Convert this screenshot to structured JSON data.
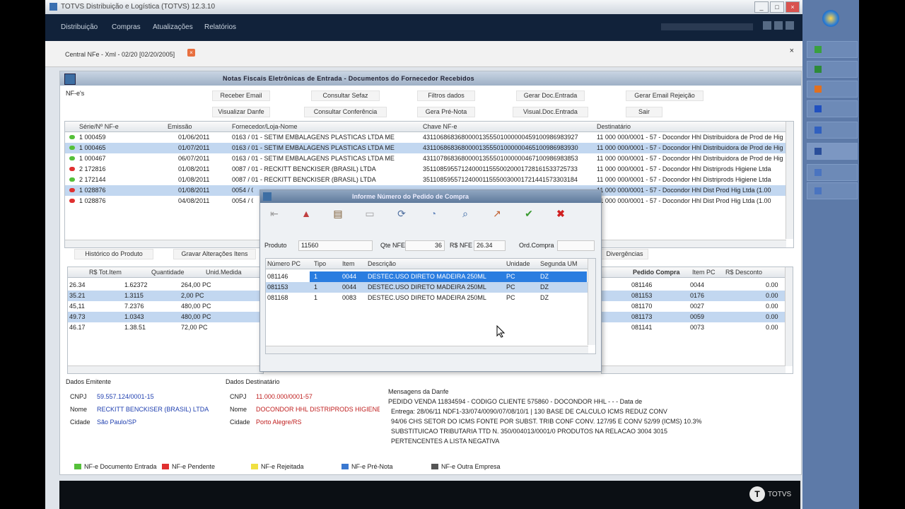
{
  "window": {
    "title": "TOTVS Distribuição e Logística (TOTVS) 12.3.10",
    "minimize": "_",
    "maximize": "□",
    "close": "×"
  },
  "menu": [
    "Distribuição",
    "Compras",
    "Atualizações",
    "Relatórios"
  ],
  "tab": {
    "label": "Central NFe - Xml - 02/20 [02/20/2005]",
    "close": "×",
    "panel_close": "×"
  },
  "panel": {
    "title": "Notas Fiscais Eletrônicas de Entrada - Documentos do Fornecedor Recebidos"
  },
  "nfe_label": "NF-e's",
  "buttons_row1": [
    "Receber Email",
    "Consultar Sefaz",
    "Filtros dados",
    "Gerar Doc.Entrada",
    "Gerar Email Rejeição"
  ],
  "buttons_row2": [
    "Visualizar Danfe",
    "Consultar Conferência",
    "Gera Pré-Nota",
    "Visual.Doc.Entrada",
    "Sair"
  ],
  "top_grid": {
    "headers": [
      "Série/Nº NF-e",
      "Emissão",
      "Fornecedor/Loja-Nome",
      "Chave NF-e",
      "Destinatário"
    ],
    "rows": [
      {
        "status": "green",
        "num": "1 000459",
        "date": "01/06/2011",
        "forn": "0163 / 01 - SETIM EMBALAGENS PLASTICAS LTDA ME",
        "chave": "43110686836800001355501000000459100986983927",
        "dest": "11 000 000/0001 - 57 - Docondor Hhl Distribuidora de Prod de Hig"
      },
      {
        "status": "green",
        "num": "1 000465",
        "date": "01/07/2011",
        "forn": "0163 / 01 - SETIM EMBALAGENS PLASTICAS LTDA ME",
        "chave": "43110686836800001355501000000465100986983930",
        "dest": "11 000 000/0001 - 57 - Docondor Hhl Distribuidora de Prod de Hig"
      },
      {
        "status": "green",
        "num": "1 000467",
        "date": "06/07/2011",
        "forn": "0163 / 01 - SETIM EMBALAGENS PLASTICAS LTDA ME",
        "chave": "43110786836800001355501000000467100986983853",
        "dest": "11 000 000/0001 - 57 - Docondor Hhl Distribuidora de Prod de Hig"
      },
      {
        "status": "red",
        "num": "2 172816",
        "date": "01/08/2011",
        "forn": "0087 / 01 - RECKITT BENCKISER (BRASIL) LTDA",
        "chave": "35110859557124000115550020001728161533725733",
        "dest": "11 000 000/0001 - 57 - Docondor Hhl Distriprods Higiene Ltda"
      },
      {
        "status": "green",
        "num": "2 172144",
        "date": "01/08/2011",
        "forn": "0087 / 01 - RECKITT BENCKISER (BRASIL) LTDA",
        "chave": "35110859557124000115550030001721441573303184",
        "dest": "11 000 000/0001 - 57 - Docondor Hhl Distriprods Higiene Ltda"
      },
      {
        "status": "red",
        "num": "1 028876",
        "date": "01/08/2011",
        "forn": "0054 / 01 - ...",
        "chave": "...",
        "dest": "11 000 000/0001 - 57 - Docondor Hhl Dist Prod Hig Ltda (1.00"
      },
      {
        "status": "red",
        "num": "1 028876",
        "date": "04/08/2011",
        "forn": "0054 / 01 - ...",
        "chave": "...",
        "dest": "11 000 000/0001 - 57 - Docondor Hhl Dist Prod Hig Ltda (1.00"
      }
    ]
  },
  "mid_buttons": [
    "Histórico do Produto",
    "Gravar Alterações Itens",
    "Divergências"
  ],
  "items_grid": {
    "headers": [
      "R$ Tot.Item",
      "Quantidade",
      "Unid.Medida"
    ],
    "rows": [
      [
        "26.34",
        "1.62372",
        "264,00 PC"
      ],
      [
        "35.21",
        "1.3115",
        "2,00 PC"
      ],
      [
        "45,11",
        "7.2376",
        "480,00 PC"
      ],
      [
        "49.73",
        "1.0343",
        "480,00 PC"
      ],
      [
        "46.17",
        "1.38.51",
        "72,00 PC"
      ]
    ]
  },
  "right_grid": {
    "headers": [
      "Pedido Compra",
      "Item PC",
      "R$ Desconto"
    ],
    "rows": [
      [
        "081146",
        "0044",
        "0.00"
      ],
      [
        "081153",
        "0176",
        "0.00"
      ],
      [
        "081170",
        "0027",
        "0.00"
      ],
      [
        "081173",
        "0059",
        "0.00"
      ],
      [
        "081141",
        "0073",
        "0.00"
      ]
    ]
  },
  "modal": {
    "title": "Informe Número do Pedido de Compra",
    "produto_label": "Produto",
    "produto_value": "11560",
    "qte_label": "Qte NFE",
    "qte_value": "36",
    "rs_label": "R$ NFE",
    "rs_value": "26.34",
    "ord_label": "Ord.Compra",
    "ord_value": "",
    "grid_headers": [
      "Número PC",
      "Tipo",
      "Item",
      "Descrição",
      "Unidade",
      "Segunda UM"
    ],
    "grid_rows": [
      {
        "pc": "081146",
        "tipo": "1",
        "item": "0044",
        "desc": "DESTEC.USO DIRETO MADEIRA 250ML",
        "un": "PC",
        "seg": "DZ"
      },
      {
        "pc": "081153",
        "tipo": "1",
        "item": "0044",
        "desc": "DESTEC.USO DIRETO MADEIRA 250ML",
        "un": "PC",
        "seg": "DZ"
      },
      {
        "pc": "081168",
        "tipo": "1",
        "item": "0083",
        "desc": "DESTEC.USO DIRETO MADEIRA 250ML",
        "un": "PC",
        "seg": "DZ"
      }
    ]
  },
  "emitente": {
    "section": "Dados Emitente",
    "cnpj_label": "CNPJ",
    "cnpj": "59.557.124/0001-15",
    "nome_label": "Nome",
    "nome": "RECKITT BENCKISER (BRASIL) LTDA",
    "cidade_label": "Cidade",
    "cidade": "São Paulo/SP"
  },
  "destinatario": {
    "section": "Dados Destinatário",
    "cnpj_label": "CNPJ",
    "cnpj": "11.000.000/0001-57",
    "nome_label": "Nome",
    "nome": "DOCONDOR HHL DISTRIPRODS HIGIENE LTDA",
    "cidade_label": "Cidade",
    "cidade": "Porto Alegre/RS"
  },
  "mensagem": {
    "section": "Mensagens da Danfe",
    "lines": [
      "PEDIDO VENDA 11834594 - CODIGO CLIENTE 575860 - DOCONDOR HHL - - - Data de",
      "Entrega: 28/06/11 NDF1-33/074/0090/07/08/10/1 | 130 BASE DE CALCULO ICMS REDUZ CONV",
      "94/06 CHS SETOR DO ICMS FONTE POR SUBST. TRIB CONF CONV. 127/95 E CONV 52/99 (ICMS) 10.3%",
      "SUBSTITUICAO TRIBUTARIA TTD N. 350/004013/0001/0 PRODUTOS NA RELACAO 3004 3015",
      "PERTENCENTES A LISTA NEGATIVA"
    ]
  },
  "legend": [
    {
      "label": "NF-e Documento Entrada",
      "color": "#55c03a"
    },
    {
      "label": "NF-e Pendente",
      "color": "#e03030"
    },
    {
      "label": "NF-e Rejeitada",
      "color": "#f0e040"
    },
    {
      "label": "NF-e Pré-Nota",
      "color": "#3a78d0"
    },
    {
      "label": "NF-e Outra Empresa",
      "color": "#555555"
    }
  ],
  "brand": {
    "logo": "T",
    "name": "TOTVS"
  }
}
